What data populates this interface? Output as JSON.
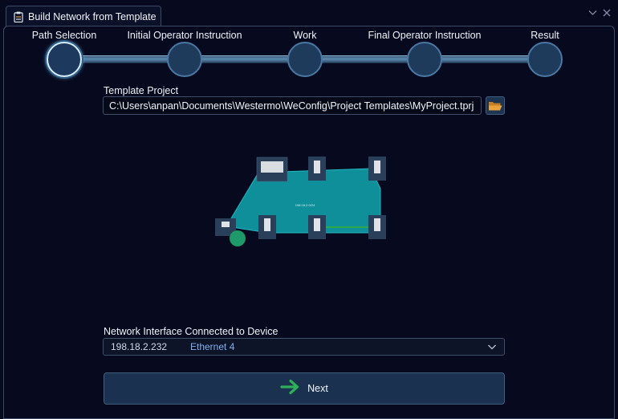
{
  "window": {
    "tab_title": "Build Network from Template"
  },
  "steps": [
    {
      "label": "Path Selection",
      "active": true
    },
    {
      "label": "Initial Operator Instruction",
      "active": false
    },
    {
      "label": "Work",
      "active": false
    },
    {
      "label": "Final Operator Instruction",
      "active": false
    },
    {
      "label": "Result",
      "active": false
    }
  ],
  "template": {
    "label": "Template Project",
    "path": "C:\\Users\\anpan\\Documents\\Westermo\\WeConfig\\Project Templates\\MyProject.tprj"
  },
  "preview": {
    "subnet": "198.18.2.0/24"
  },
  "interface": {
    "label": "Network Interface Connected to Device",
    "ip": "198.18.2.232",
    "name": "Ethernet 4"
  },
  "next_button": {
    "label": "Next"
  },
  "colors": {
    "background": "#070a1e",
    "accent": "#1f3b5c",
    "network_fill": "#0f8f99",
    "next_arrow": "#2eaf5a",
    "folder": "#e8a33c"
  }
}
